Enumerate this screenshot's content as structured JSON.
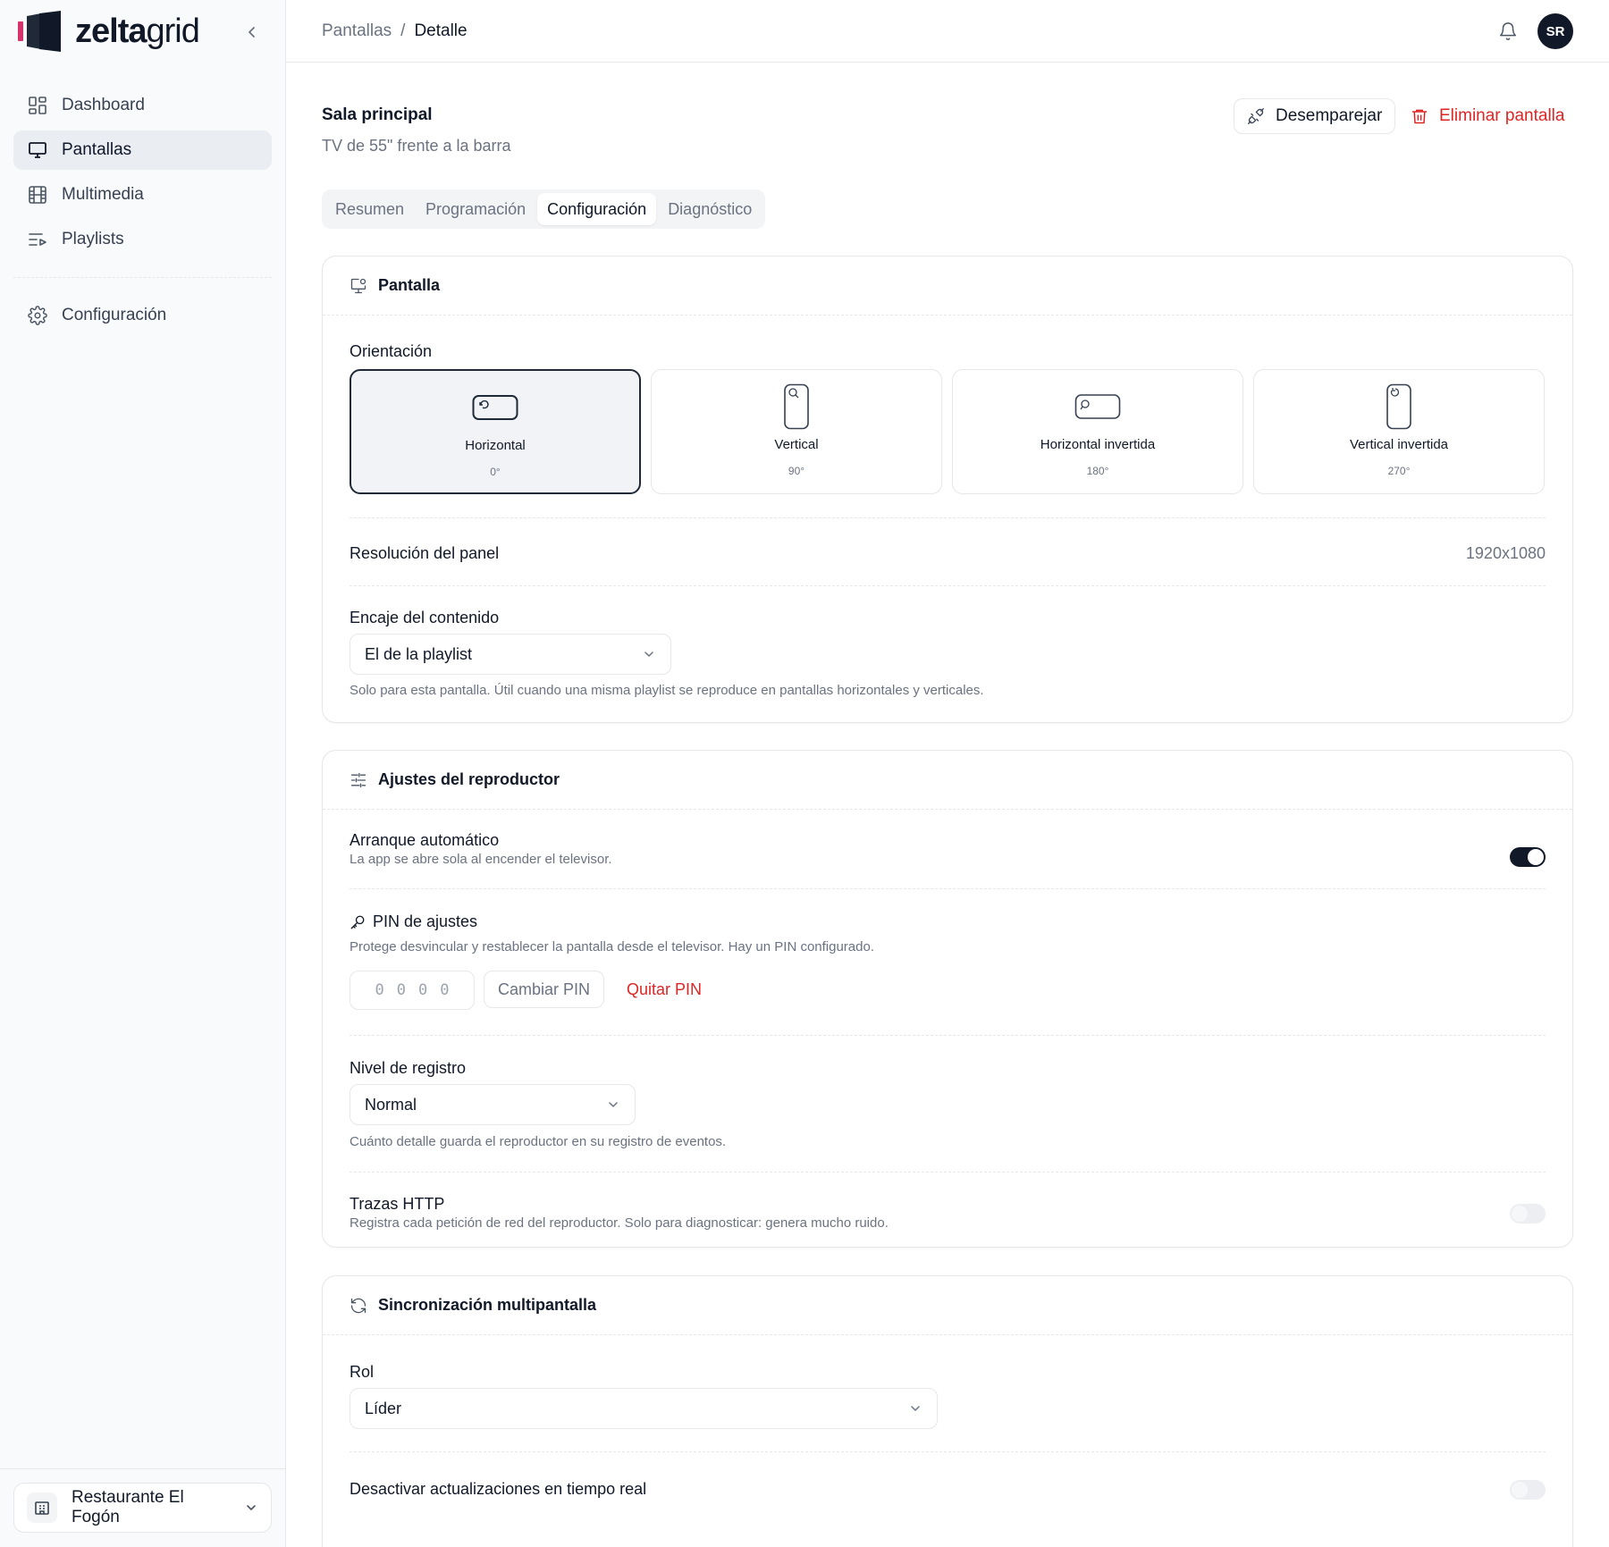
{
  "app": {
    "logo_bold": "zelta",
    "logo_light": "grid"
  },
  "sidebar": {
    "items": [
      {
        "label": "Dashboard",
        "icon": "dashboard-icon"
      },
      {
        "label": "Pantallas",
        "icon": "monitor-icon",
        "active": true
      },
      {
        "label": "Multimedia",
        "icon": "film-icon"
      },
      {
        "label": "Playlists",
        "icon": "playlist-icon"
      }
    ],
    "settings_label": "Configuración",
    "org_name": "Restaurante El Fogón"
  },
  "header": {
    "breadcrumb": [
      "Pantallas",
      "Detalle"
    ],
    "breadcrumb_sep": "/",
    "avatar_initials": "SR"
  },
  "page": {
    "title": "Sala principal",
    "subtitle": "TV de 55\" frente a la barra",
    "unpair_label": "Desemparejar",
    "delete_label": "Eliminar pantalla",
    "tabs": [
      "Resumen",
      "Programación",
      "Configuración",
      "Diagnóstico"
    ],
    "active_tab": "Configuración"
  },
  "screen_card": {
    "title": "Pantalla",
    "orientation_label": "Orientación",
    "orientations": [
      {
        "name": "Horizontal",
        "deg": "0°",
        "selected": true
      },
      {
        "name": "Vertical",
        "deg": "90°"
      },
      {
        "name": "Horizontal invertida",
        "deg": "180°"
      },
      {
        "name": "Vertical invertida",
        "deg": "270°"
      }
    ],
    "resolution_label": "Resolución del panel",
    "resolution_value": "1920x1080",
    "fit_label": "Encaje del contenido",
    "fit_value": "El de la playlist",
    "fit_help": "Solo para esta pantalla. Útil cuando una misma playlist se reproduce en pantallas horizontales y verticales."
  },
  "player_card": {
    "title": "Ajustes del reproductor",
    "autostart_label": "Arranque automático",
    "autostart_help": "La app se abre sola al encender el televisor.",
    "autostart_on": true,
    "pin_label": "PIN de ajustes",
    "pin_help": "Protege desvincular y restablecer la pantalla desde el televisor. Hay un PIN configurado.",
    "pin_placeholder": "0000",
    "change_pin_label": "Cambiar PIN",
    "remove_pin_label": "Quitar PIN",
    "log_level_label": "Nivel de registro",
    "log_level_value": "Normal",
    "log_level_help": "Cuánto detalle guarda el reproductor en su registro de eventos.",
    "http_label": "Trazas HTTP",
    "http_help": "Registra cada petición de red del reproductor. Solo para diagnosticar: genera mucho ruido.",
    "http_on": false
  },
  "sync_card": {
    "title": "Sincronización multipantalla",
    "role_label": "Rol",
    "role_value": "Líder",
    "realtime_label": "Desactivar actualizaciones en tiempo real",
    "realtime_on": false
  },
  "colors": {
    "accent": "#111827",
    "danger": "#dc2626",
    "logo_pink": "#d6336c"
  }
}
